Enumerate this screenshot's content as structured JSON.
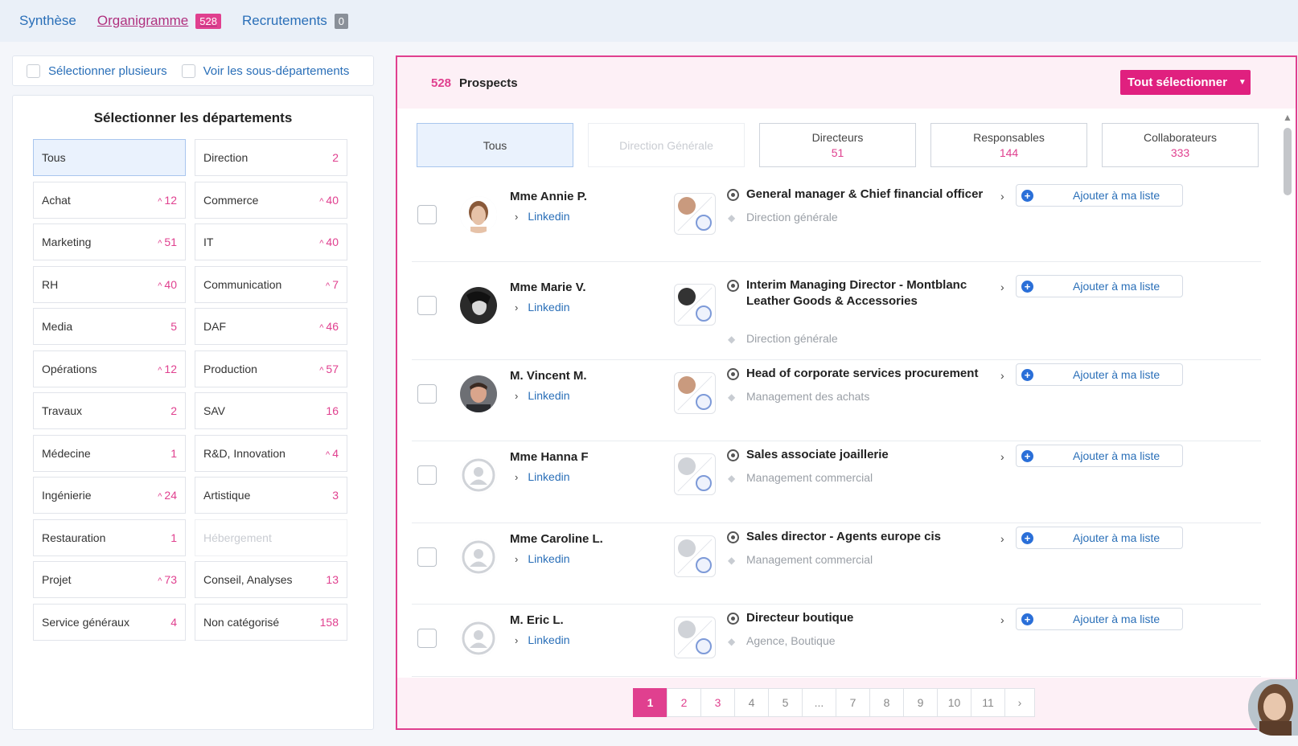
{
  "nav": {
    "synthese": "Synthèse",
    "organigramme": "Organigramme",
    "organigramme_count": "528",
    "recrutements": "Recrutements",
    "recrutements_count": "0"
  },
  "options": {
    "select_multiple": "Sélectionner plusieurs",
    "show_sub": "Voir les sous-départements"
  },
  "departments": {
    "title": "Sélectionner les départements",
    "left": [
      {
        "label": "Tous",
        "count": "",
        "up": false,
        "selected": true
      },
      {
        "label": "Achat",
        "count": "12",
        "up": true
      },
      {
        "label": "Marketing",
        "count": "51",
        "up": true
      },
      {
        "label": "RH",
        "count": "40",
        "up": true
      },
      {
        "label": "Media",
        "count": "5",
        "up": false
      },
      {
        "label": "Opérations",
        "count": "12",
        "up": true
      },
      {
        "label": "Travaux",
        "count": "2",
        "up": false
      },
      {
        "label": "Médecine",
        "count": "1",
        "up": false
      },
      {
        "label": "Ingénierie",
        "count": "24",
        "up": true
      },
      {
        "label": "Restauration",
        "count": "1",
        "up": false
      },
      {
        "label": "Projet",
        "count": "73",
        "up": true
      },
      {
        "label": "Service généraux",
        "count": "4",
        "up": false
      }
    ],
    "right": [
      {
        "label": "Direction",
        "count": "2",
        "up": false
      },
      {
        "label": "Commerce",
        "count": "40",
        "up": true
      },
      {
        "label": "IT",
        "count": "40",
        "up": true
      },
      {
        "label": "Communication",
        "count": "7",
        "up": true
      },
      {
        "label": "DAF",
        "count": "46",
        "up": true
      },
      {
        "label": "Production",
        "count": "57",
        "up": true
      },
      {
        "label": "SAV",
        "count": "16",
        "up": false
      },
      {
        "label": "R&D, Innovation",
        "count": "4",
        "up": true
      },
      {
        "label": "Artistique",
        "count": "3",
        "up": false
      },
      {
        "label": "Hébergement",
        "count": "",
        "up": false,
        "disabled": true
      },
      {
        "label": "Conseil, Analyses",
        "count": "13",
        "up": false
      },
      {
        "label": "Non catégorisé",
        "count": "158",
        "up": false
      }
    ]
  },
  "panel": {
    "count": "528",
    "label": "Prospects",
    "select_all": "Tout sélectionner"
  },
  "tabs": [
    {
      "label": "Tous",
      "count": ""
    },
    {
      "label": "Direction Générale",
      "count": ""
    },
    {
      "label": "Directeurs",
      "count": "51"
    },
    {
      "label": "Responsables",
      "count": "144"
    },
    {
      "label": "Collaborateurs",
      "count": "333"
    }
  ],
  "prospects": [
    {
      "name": "Mme Annie P.",
      "link": "Linkedin",
      "title": "General manager & Chief financial officer",
      "department": "Direction générale",
      "add": "Ajouter à ma liste",
      "avatar": "photo-a"
    },
    {
      "name": "Mme Marie V.",
      "link": "Linkedin",
      "title": "Interim Managing Director - Montblanc Leather Goods & Accessories",
      "department": "Direction générale",
      "add": "Ajouter à ma liste",
      "avatar": "photo-b"
    },
    {
      "name": "M. Vincent M.",
      "link": "Linkedin",
      "title": "Head of corporate services procurement",
      "department": "Management des achats",
      "add": "Ajouter à ma liste",
      "avatar": "photo-c"
    },
    {
      "name": "Mme Hanna F",
      "link": "Linkedin",
      "title": "Sales associate joaillerie",
      "department": "Management commercial",
      "add": "Ajouter à ma liste",
      "avatar": "default"
    },
    {
      "name": "Mme Caroline L.",
      "link": "Linkedin",
      "title": "Sales director - Agents europe cis",
      "department": "Management commercial",
      "add": "Ajouter à ma liste",
      "avatar": "default"
    },
    {
      "name": "M. Eric L.",
      "link": "Linkedin",
      "title": "Directeur boutique",
      "department": "Agence, Boutique",
      "add": "Ajouter à ma liste",
      "avatar": "default"
    }
  ],
  "pagination": [
    "1",
    "2",
    "3",
    "4",
    "5",
    "...",
    "7",
    "8",
    "9",
    "10",
    "11"
  ],
  "pagination_next": "›",
  "colors": {
    "accent": "#e0408f",
    "link": "#2a6fb8",
    "button": "#e0207f"
  }
}
